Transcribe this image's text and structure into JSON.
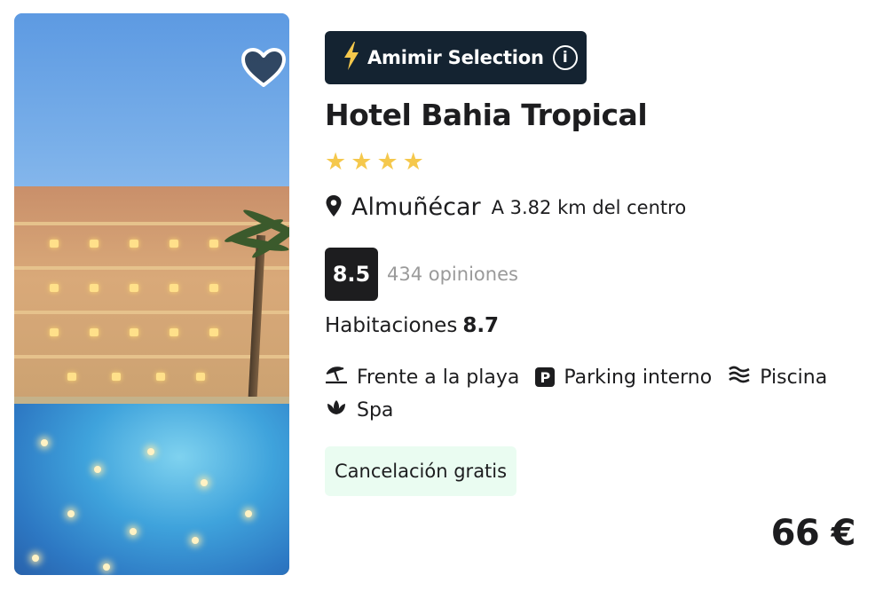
{
  "hotel": {
    "badge": {
      "label": "Amimir Selection",
      "icon": "lightning-icon",
      "info_icon": "info-icon",
      "bolt_color": "#f5c84c"
    },
    "name": "Hotel Bahia Tropical",
    "stars": 4,
    "star_color": "#f5c84c",
    "location": {
      "city": "Almuñécar",
      "distance": "A 3.82 km del centro",
      "icon": "map-pin-icon"
    },
    "rating": {
      "score": "8.5",
      "reviews": "434 opiniones"
    },
    "rooms": {
      "label": "Habitaciones",
      "score": "8.7"
    },
    "amenities": [
      {
        "icon": "beach-umbrella-icon",
        "label": "Frente a la playa"
      },
      {
        "icon": "parking-icon",
        "label": "Parking interno",
        "glyph": "P"
      },
      {
        "icon": "waves-icon",
        "label": "Piscina"
      },
      {
        "icon": "lotus-icon",
        "label": "Spa"
      }
    ],
    "cancellation": "Cancelación gratis",
    "price": "66 €",
    "favorite_icon": "heart-icon",
    "photo": "hotel-photo"
  },
  "colors": {
    "badge_bg": "#142331",
    "cancel_bg": "#eafcf1",
    "score_bg": "#1d1d1f"
  }
}
